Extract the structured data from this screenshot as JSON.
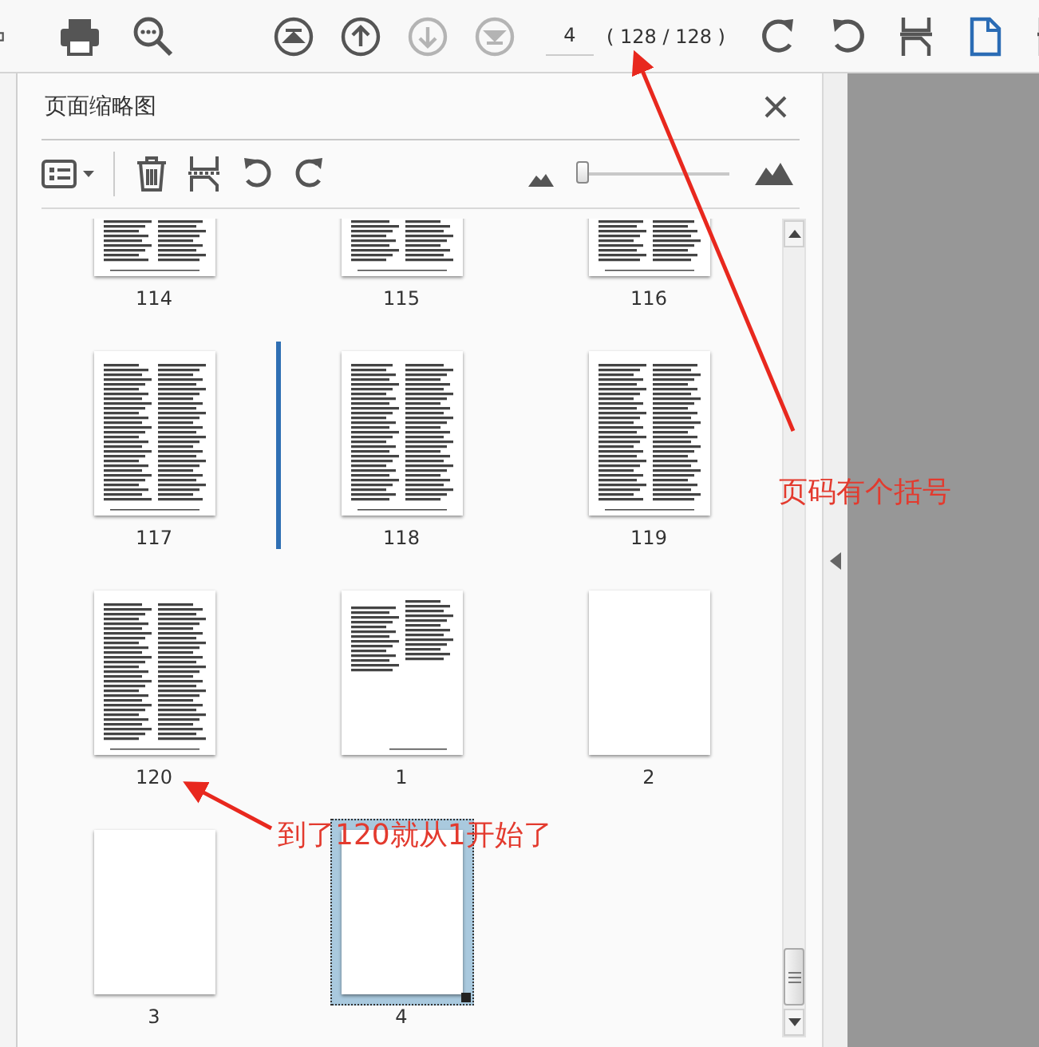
{
  "toolbar": {
    "buttons": [
      {
        "kind": "cut",
        "disabled": false
      },
      {
        "kind": "print",
        "disabled": false
      },
      {
        "kind": "zoom",
        "disabled": false
      },
      {
        "kind": "first",
        "disabled": false
      },
      {
        "kind": "prev",
        "disabled": false
      },
      {
        "kind": "next",
        "disabled": true
      },
      {
        "kind": "last",
        "disabled": true
      }
    ],
    "page_field": {
      "value": "4"
    },
    "page_count": "( 128 / 128 )",
    "view_buttons": [
      {
        "kind": "rotate-cw",
        "selected": false
      },
      {
        "kind": "rotate-ccw",
        "selected": false
      },
      {
        "kind": "fit",
        "selected": false
      },
      {
        "kind": "page",
        "selected": true
      },
      {
        "kind": "fit",
        "selected": false
      }
    ]
  },
  "panel": {
    "title": "页面缩略图",
    "slider": {
      "level": 0.0
    },
    "thumbnails": [
      {
        "label": "114",
        "kind": "text",
        "selected": false,
        "insert_before": false
      },
      {
        "label": "115",
        "kind": "text",
        "selected": false,
        "insert_before": false
      },
      {
        "label": "116",
        "kind": "text",
        "selected": false,
        "insert_before": false
      },
      {
        "label": "117",
        "kind": "text",
        "selected": false,
        "insert_before": false
      },
      {
        "label": "118",
        "kind": "text",
        "selected": false,
        "insert_before": true
      },
      {
        "label": "119",
        "kind": "text",
        "selected": false,
        "insert_before": false
      },
      {
        "label": "120",
        "kind": "text",
        "selected": false,
        "insert_before": false
      },
      {
        "label": "1",
        "kind": "partial",
        "selected": false,
        "insert_before": false
      },
      {
        "label": "2",
        "kind": "blank",
        "selected": false,
        "insert_before": false
      },
      {
        "label": "3",
        "kind": "blank",
        "selected": false,
        "insert_before": false
      },
      {
        "label": "4",
        "kind": "blank",
        "selected": true,
        "insert_before": false
      }
    ]
  },
  "annotations": [
    {
      "text": "页码有个括号"
    },
    {
      "text": "到了120就从1开始了"
    }
  ]
}
